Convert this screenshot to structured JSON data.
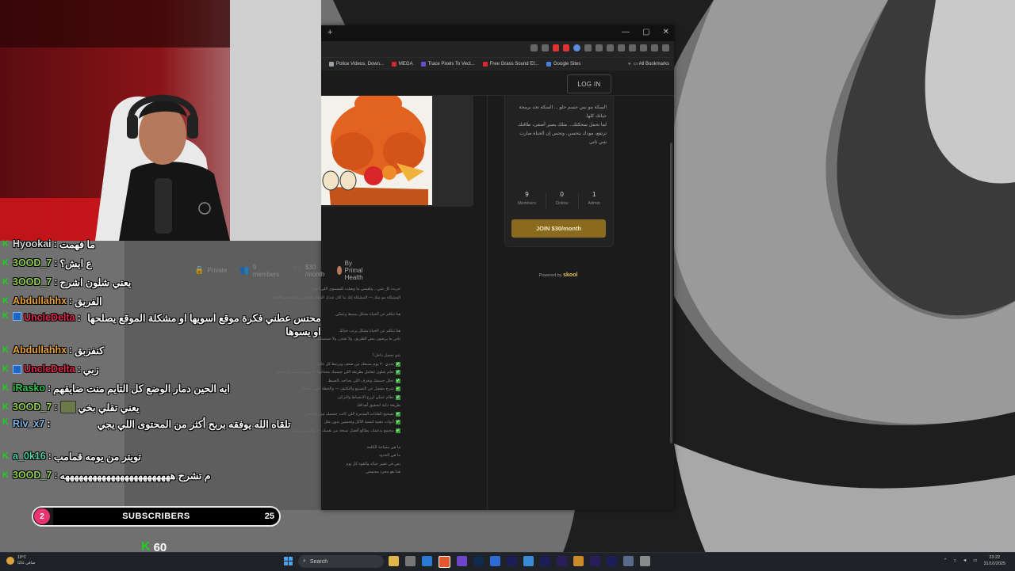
{
  "browser": {
    "tab_new": "+",
    "window_controls": [
      "—",
      "▢",
      "✕"
    ],
    "bookmarks": [
      {
        "label": "Police Videos, Down...",
        "color": "#9aa0a6"
      },
      {
        "label": "MEGA",
        "color": "#d9272e"
      },
      {
        "label": "Trace Pixels To Vect...",
        "color": "#6b4bd8"
      },
      {
        "label": "Free Grass Sound Ef...",
        "color": "#d9272e"
      },
      {
        "label": "Google Sites",
        "color": "#4a7fe0"
      }
    ],
    "all_bookmarks": "All Bookmarks",
    "login": "LOG IN"
  },
  "group": {
    "privacy": "Private",
    "members": "9 members",
    "price": "$30 /month",
    "owner": "By Primal Health",
    "about_lines": [
      "السكة مو بس جسم حلو ... السكة تجد برمجة",
      "حياتك كلها.",
      "لما تحمل سحكتك... مثلك يصير أصفى، طاقتك",
      "ترتفع، مودك يتحسن، وتحس إن الحياة صارت",
      "شي ثاني"
    ],
    "stats": [
      {
        "value": "9",
        "label": "Members"
      },
      {
        "value": "0",
        "label": "Online"
      },
      {
        "value": "1",
        "label": "Admin"
      }
    ],
    "join_label": "JOIN $30/month",
    "powered_prefix": "Powered by",
    "powered_brand": "skool",
    "description": [
      {
        "text": "جربت كل شي... ولقيتني ما وصلت للمستوى اللي أبغاه؟",
        "check": false
      },
      {
        "text": "المشكلة مو منك — المشكلة إنك ما كان عندك النظام الصح... ولا المجتمع الصح",
        "check": false
      },
      {
        "text": "",
        "check": false
      },
      {
        "text": "هنا نتكلم عن الحياة بشكل بسيط وعملي",
        "check": false
      },
      {
        "text": "",
        "check": false
      },
      {
        "text": "هنا نتكلم عن الحياة بشكل يرتب حياتك",
        "check": false
      },
      {
        "text": "ناس ما يرضون بنص الطريق، ولا تعتذر، ولا تستسلم",
        "check": false
      },
      {
        "text": "",
        "check": false
      },
      {
        "text": "شو تحصل داخل؟",
        "check": false
      },
      {
        "text": "تحدي ٣٠ يوم يسبقك من ضعف ويرتبط كل عادة",
        "check": true
      },
      {
        "text": "تعلم شلون تتعامل بطريقة اللي جسمك محتاجها — بدون حساب ولا تعقيد",
        "check": true
      },
      {
        "text": "تحلل جسمك وتعرف اللي يحتاجه بالضبط",
        "check": true
      },
      {
        "text": "شرح مفصل عن التصنيع والتكثيف — والخطة اللي تناسبك",
        "check": true
      },
      {
        "text": "نظام عملي لزرع الانضباط والتركيز",
        "check": true
      },
      {
        "text": "طريقة ذكية لتحقيق أهدافك",
        "check": false
      },
      {
        "text": "تصحيح العادات المدمرة اللي كانت جسمك تبين ما تحس",
        "check": true
      },
      {
        "text": "أدوات ذهبية لتنمية الأكل وتحسين بدون ملل",
        "check": true
      },
      {
        "text": "مجتمع يدعمك، يطالع أفضل نسخة من نفسك — وأكثر من جدي",
        "check": true
      },
      {
        "text": "",
        "check": false
      },
      {
        "text": "ما هي مساحة الكلمة",
        "check": false
      },
      {
        "text": "ما هي الحدود",
        "check": false
      },
      {
        "text": "بس في تغيير حياته والقوة كل يوم",
        "check": false
      },
      {
        "text": "هذا هو مجرد مجتمعي",
        "check": false
      }
    ]
  },
  "chat": [
    {
      "user": "Hyookai",
      "user_color": "#d8d8d8",
      "text": "ما فهمت",
      "badge": false
    },
    {
      "user": "3OOD_7",
      "user_color": "#8fd14f",
      "text": "ع ايش؟",
      "badge": false
    },
    {
      "user": "3OOD_7",
      "user_color": "#8fd14f",
      "text": "يعني شلون اشرح",
      "badge": false
    },
    {
      "user": "Abdullahhx",
      "user_color": "#e9a23b",
      "text": "الفريق",
      "badge": false
    },
    {
      "user": "UncleDelta",
      "user_color": "#e0264b",
      "text": "محتس عطني فكرة موقع اسويها او مشكلة الموقع يصلحها او يسوها",
      "badge": true
    },
    {
      "user": "Abdullahhx",
      "user_color": "#e9a23b",
      "text": "كنفزبق",
      "badge": false
    },
    {
      "user": "UncleDelta",
      "user_color": "#e0264b",
      "text": "زبي",
      "badge": true
    },
    {
      "user": "iRasko",
      "user_color": "#2fc24c",
      "text": "ايه الحين دمار الوضع كل التايم منت ضايقهم",
      "badge": false
    },
    {
      "user": "3OOD_7",
      "user_color": "#8fd14f",
      "text": "يعني تقلي بخي",
      "badge": false,
      "emote": true
    },
    {
      "user": "Riv_x7",
      "user_color": "#7fb6e6",
      "text": "تلقاه الله يوفقه بربح أكثر من المحتوى اللي يجي",
      "badge": false
    },
    {
      "user": "a_0k16",
      "user_color": "#4fd1a0",
      "text": "تويتر من يومه قمامب",
      "badge": false
    },
    {
      "user": "3OOD_7",
      "user_color": "#8fd14f",
      "text": "م تشرح ههههههههههههههههههههههههه",
      "badge": false
    }
  ],
  "subscribers": {
    "label": "SUBSCRIBERS",
    "current": "2",
    "goal": "25",
    "progress": 0.08
  },
  "kick_followers": "60",
  "taskbar": {
    "weather_temp": "19°C",
    "weather_desc": "صافي غالبًا",
    "search": "Search",
    "time": "23:22",
    "date": "31/10/2025"
  }
}
